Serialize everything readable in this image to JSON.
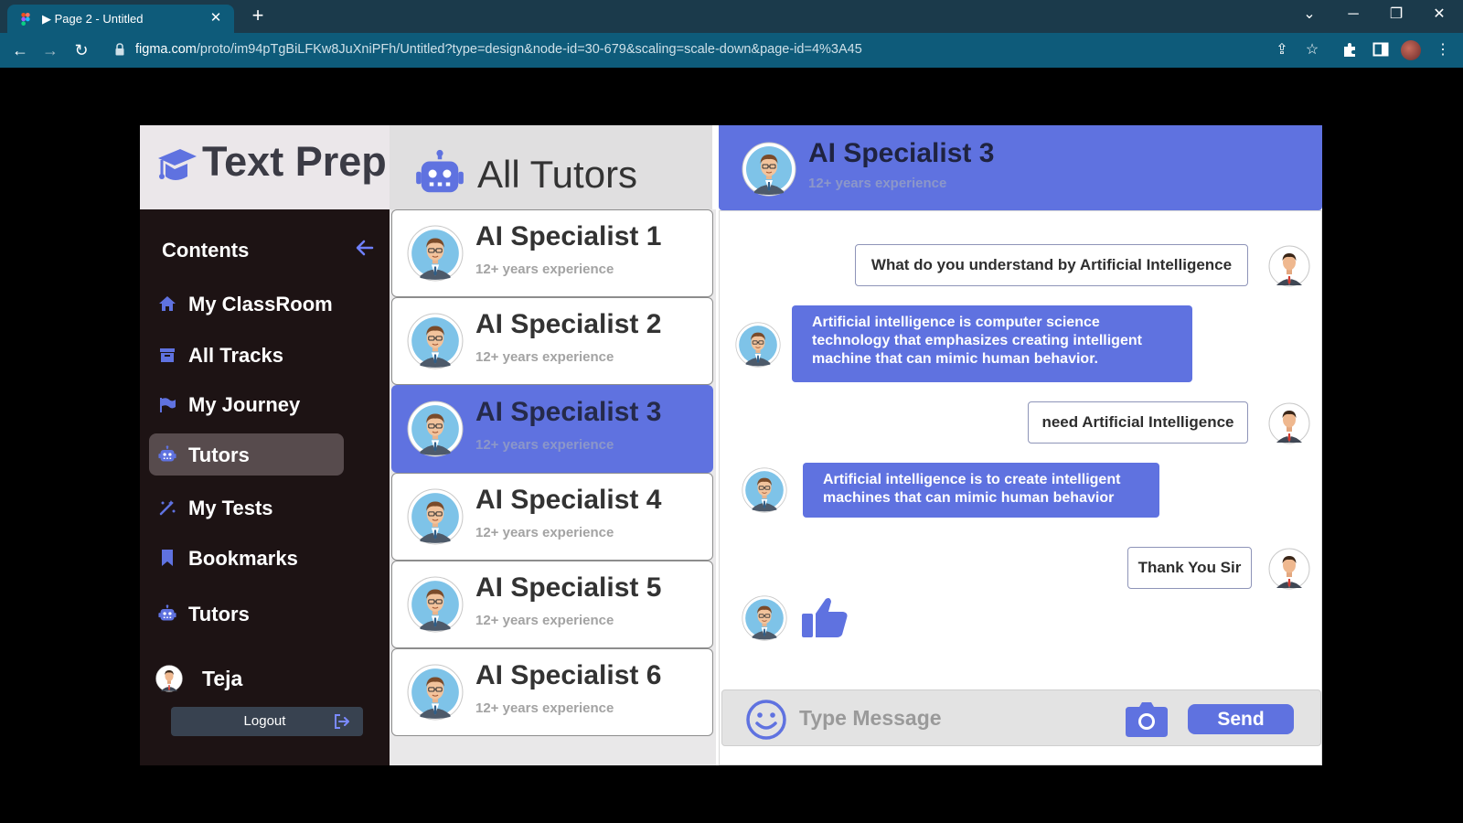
{
  "browser": {
    "tab_title": "▶ Page 2 - Untitled",
    "url_host": "figma.com",
    "url_path": "/proto/im94pTgBiLFKw8JuXniPFh/Untitled?type=design&node-id=30-679&scaling=scale-down&page-id=4%3A45"
  },
  "app": {
    "logo_text": "Text Prep",
    "sidebar": {
      "title": "Contents",
      "items": [
        {
          "label": "My ClassRoom",
          "icon": "home-icon",
          "active": false
        },
        {
          "label": "All Tracks",
          "icon": "archive-icon",
          "active": false
        },
        {
          "label": "My Journey",
          "icon": "flag-icon",
          "active": false
        },
        {
          "label": "Tutors",
          "icon": "robot-icon",
          "active": true
        },
        {
          "label": "My Tests",
          "icon": "magic-wand-icon",
          "active": false
        },
        {
          "label": "Bookmarks",
          "icon": "bookmark-icon",
          "active": false
        },
        {
          "label": "Tutors",
          "icon": "robot-icon",
          "active": false
        }
      ],
      "user_name": "Teja",
      "logout_label": "Logout"
    },
    "tutors": {
      "title": "All Tutors",
      "items": [
        {
          "name": "AI Specialist 1",
          "experience": "12+ years experience"
        },
        {
          "name": "AI Specialist 2",
          "experience": "12+ years experience"
        },
        {
          "name": "AI Specialist 3",
          "experience": "12+ years experience"
        },
        {
          "name": "AI Specialist 4",
          "experience": "12+ years experience"
        },
        {
          "name": "AI Specialist 5",
          "experience": "12+ years experience"
        },
        {
          "name": "AI Specialist 6",
          "experience": "12+ years experience"
        }
      ],
      "selected": "AI Specialist 3"
    },
    "chat": {
      "tutor_name": "AI Specialist 3",
      "tutor_experience": "12+ years experience",
      "messages": [
        {
          "from": "user",
          "text": "What do you understand by Artificial Intelligence"
        },
        {
          "from": "tutor",
          "text": "Artificial intelligence is computer science technology that emphasizes creating intelligent machine that can mimic human behavior."
        },
        {
          "from": "user",
          "text": "need Artificial Intelligence"
        },
        {
          "from": "tutor",
          "text": "Artificial intelligence is to create intelligent machines that can mimic human behavior"
        },
        {
          "from": "user",
          "text": "Thank You Sir"
        },
        {
          "from": "tutor",
          "icon": "thumbs-up-icon"
        }
      ],
      "input_placeholder": "Type Message",
      "send_label": "Send"
    },
    "colors": {
      "accent": "#5f72e0",
      "sidebar_bg": "#1d1314",
      "active_nav_bg": "#574b4d"
    }
  }
}
